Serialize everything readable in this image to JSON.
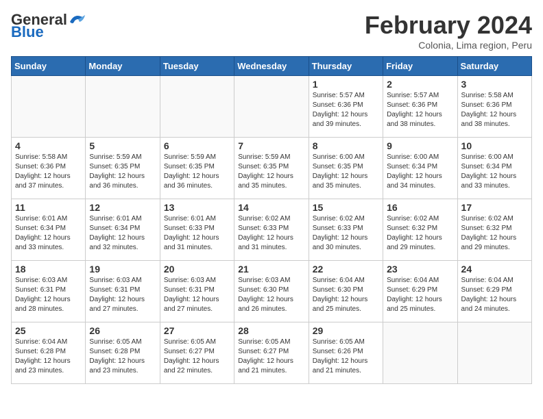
{
  "logo": {
    "general": "General",
    "blue": "Blue"
  },
  "title": {
    "month_year": "February 2024",
    "location": "Colonia, Lima region, Peru"
  },
  "days_of_week": [
    "Sunday",
    "Monday",
    "Tuesday",
    "Wednesday",
    "Thursday",
    "Friday",
    "Saturday"
  ],
  "weeks": [
    [
      {
        "day": "",
        "info": ""
      },
      {
        "day": "",
        "info": ""
      },
      {
        "day": "",
        "info": ""
      },
      {
        "day": "",
        "info": ""
      },
      {
        "day": "1",
        "info": "Sunrise: 5:57 AM\nSunset: 6:36 PM\nDaylight: 12 hours\nand 39 minutes."
      },
      {
        "day": "2",
        "info": "Sunrise: 5:57 AM\nSunset: 6:36 PM\nDaylight: 12 hours\nand 38 minutes."
      },
      {
        "day": "3",
        "info": "Sunrise: 5:58 AM\nSunset: 6:36 PM\nDaylight: 12 hours\nand 38 minutes."
      }
    ],
    [
      {
        "day": "4",
        "info": "Sunrise: 5:58 AM\nSunset: 6:36 PM\nDaylight: 12 hours\nand 37 minutes."
      },
      {
        "day": "5",
        "info": "Sunrise: 5:59 AM\nSunset: 6:35 PM\nDaylight: 12 hours\nand 36 minutes."
      },
      {
        "day": "6",
        "info": "Sunrise: 5:59 AM\nSunset: 6:35 PM\nDaylight: 12 hours\nand 36 minutes."
      },
      {
        "day": "7",
        "info": "Sunrise: 5:59 AM\nSunset: 6:35 PM\nDaylight: 12 hours\nand 35 minutes."
      },
      {
        "day": "8",
        "info": "Sunrise: 6:00 AM\nSunset: 6:35 PM\nDaylight: 12 hours\nand 35 minutes."
      },
      {
        "day": "9",
        "info": "Sunrise: 6:00 AM\nSunset: 6:34 PM\nDaylight: 12 hours\nand 34 minutes."
      },
      {
        "day": "10",
        "info": "Sunrise: 6:00 AM\nSunset: 6:34 PM\nDaylight: 12 hours\nand 33 minutes."
      }
    ],
    [
      {
        "day": "11",
        "info": "Sunrise: 6:01 AM\nSunset: 6:34 PM\nDaylight: 12 hours\nand 33 minutes."
      },
      {
        "day": "12",
        "info": "Sunrise: 6:01 AM\nSunset: 6:34 PM\nDaylight: 12 hours\nand 32 minutes."
      },
      {
        "day": "13",
        "info": "Sunrise: 6:01 AM\nSunset: 6:33 PM\nDaylight: 12 hours\nand 31 minutes."
      },
      {
        "day": "14",
        "info": "Sunrise: 6:02 AM\nSunset: 6:33 PM\nDaylight: 12 hours\nand 31 minutes."
      },
      {
        "day": "15",
        "info": "Sunrise: 6:02 AM\nSunset: 6:33 PM\nDaylight: 12 hours\nand 30 minutes."
      },
      {
        "day": "16",
        "info": "Sunrise: 6:02 AM\nSunset: 6:32 PM\nDaylight: 12 hours\nand 29 minutes."
      },
      {
        "day": "17",
        "info": "Sunrise: 6:02 AM\nSunset: 6:32 PM\nDaylight: 12 hours\nand 29 minutes."
      }
    ],
    [
      {
        "day": "18",
        "info": "Sunrise: 6:03 AM\nSunset: 6:31 PM\nDaylight: 12 hours\nand 28 minutes."
      },
      {
        "day": "19",
        "info": "Sunrise: 6:03 AM\nSunset: 6:31 PM\nDaylight: 12 hours\nand 27 minutes."
      },
      {
        "day": "20",
        "info": "Sunrise: 6:03 AM\nSunset: 6:31 PM\nDaylight: 12 hours\nand 27 minutes."
      },
      {
        "day": "21",
        "info": "Sunrise: 6:03 AM\nSunset: 6:30 PM\nDaylight: 12 hours\nand 26 minutes."
      },
      {
        "day": "22",
        "info": "Sunrise: 6:04 AM\nSunset: 6:30 PM\nDaylight: 12 hours\nand 25 minutes."
      },
      {
        "day": "23",
        "info": "Sunrise: 6:04 AM\nSunset: 6:29 PM\nDaylight: 12 hours\nand 25 minutes."
      },
      {
        "day": "24",
        "info": "Sunrise: 6:04 AM\nSunset: 6:29 PM\nDaylight: 12 hours\nand 24 minutes."
      }
    ],
    [
      {
        "day": "25",
        "info": "Sunrise: 6:04 AM\nSunset: 6:28 PM\nDaylight: 12 hours\nand 23 minutes."
      },
      {
        "day": "26",
        "info": "Sunrise: 6:05 AM\nSunset: 6:28 PM\nDaylight: 12 hours\nand 23 minutes."
      },
      {
        "day": "27",
        "info": "Sunrise: 6:05 AM\nSunset: 6:27 PM\nDaylight: 12 hours\nand 22 minutes."
      },
      {
        "day": "28",
        "info": "Sunrise: 6:05 AM\nSunset: 6:27 PM\nDaylight: 12 hours\nand 21 minutes."
      },
      {
        "day": "29",
        "info": "Sunrise: 6:05 AM\nSunset: 6:26 PM\nDaylight: 12 hours\nand 21 minutes."
      },
      {
        "day": "",
        "info": ""
      },
      {
        "day": "",
        "info": ""
      }
    ]
  ]
}
